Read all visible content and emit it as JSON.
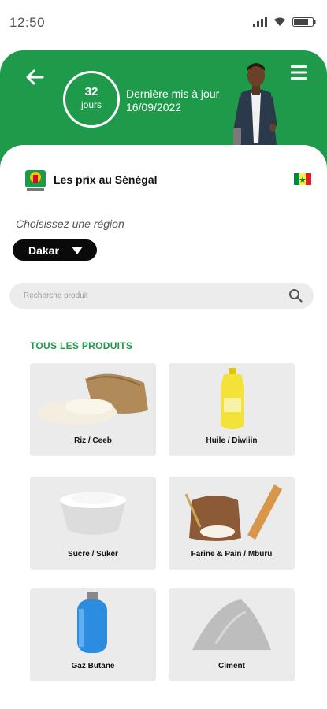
{
  "status_bar": {
    "time": "12:50"
  },
  "header": {
    "days_number": "32",
    "days_label": "jours",
    "update_label": "Dernière mis à jour",
    "update_date": "16/09/2022"
  },
  "brand": {
    "title": "Les prix au Sénégal"
  },
  "region": {
    "label": "Choisissez une région",
    "selected": "Dakar"
  },
  "search": {
    "placeholder": "Recherche produit"
  },
  "products": {
    "section_title": "TOUS LES PRODUITS",
    "items": [
      {
        "label": "Riz / Ceeb",
        "icon": "rice-sack-icon"
      },
      {
        "label": "Huile / Diwliin",
        "icon": "oil-bottle-icon"
      },
      {
        "label": "Sucre / Sukër",
        "icon": "sugar-bowl-icon"
      },
      {
        "label": "Farine & Pain / Mburu",
        "icon": "flour-bread-icon"
      },
      {
        "label": "Gaz Butane",
        "icon": "gas-cylinder-icon"
      },
      {
        "label": "Ciment",
        "icon": "cement-pile-icon"
      }
    ]
  },
  "colors": {
    "brand_green": "#1f9a4a",
    "dark": "#0a0a0a",
    "tile_bg": "#ebebeb"
  }
}
